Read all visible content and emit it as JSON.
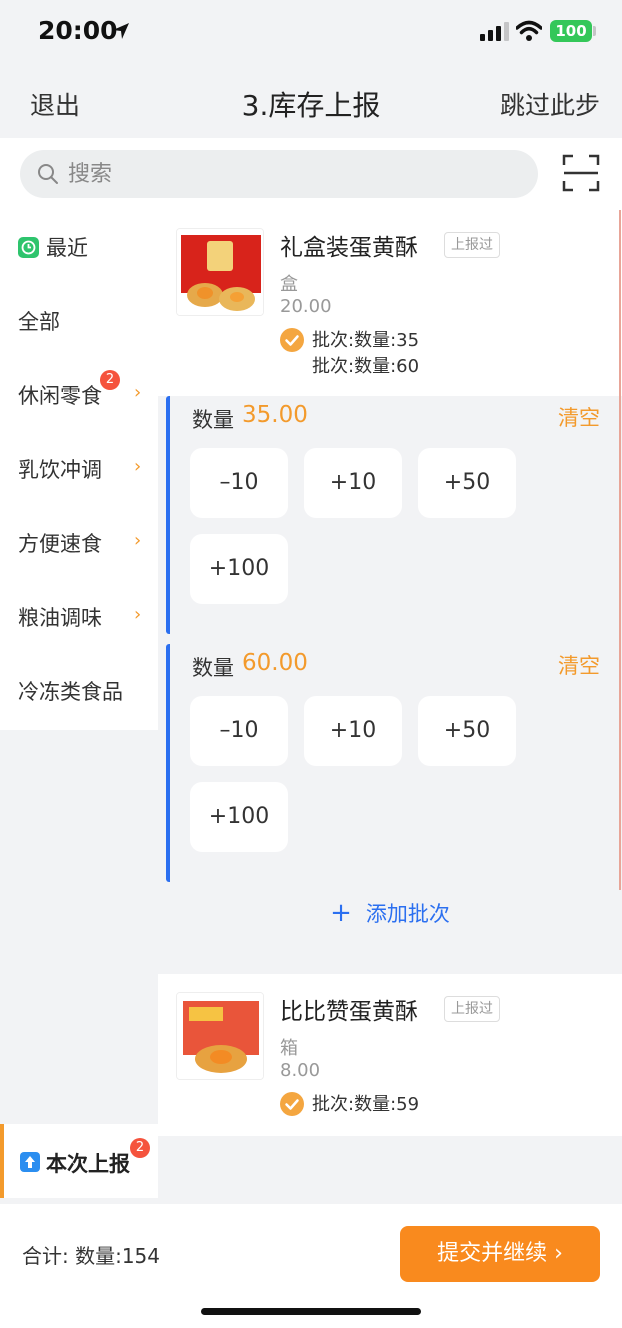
{
  "status": {
    "time": "20:00",
    "battery": "100"
  },
  "nav": {
    "left": "退出",
    "title": "3.库存上报",
    "right": "跳过此步"
  },
  "search": {
    "placeholder": "搜索"
  },
  "sidebar": {
    "items": [
      {
        "label": "最近",
        "icon": "clock-icon"
      },
      {
        "label": "全部"
      },
      {
        "label": "休闲零食",
        "badge": "2",
        "expandable": true
      },
      {
        "label": "乳饮冲调",
        "expandable": true
      },
      {
        "label": "方便速食",
        "expandable": true
      },
      {
        "label": "粮油调味",
        "expandable": true
      },
      {
        "label": "冷冻类食品"
      }
    ],
    "current_report": {
      "label": "本次上报",
      "badge": "2",
      "icon": "upload-icon"
    }
  },
  "products": [
    {
      "name": "礼盒装蛋黄酥",
      "tag": "上报过",
      "unit": "盒",
      "price": "20.00",
      "batches_summary": [
        "批次:数量:35",
        "批次:数量:60"
      ],
      "batches": [
        {
          "qty_label": "数量",
          "qty_value": "35.00",
          "clear_label": "清空",
          "buttons": [
            "–10",
            "+10",
            "+50",
            "+100"
          ]
        },
        {
          "qty_label": "数量",
          "qty_value": "60.00",
          "clear_label": "清空",
          "buttons": [
            "–10",
            "+10",
            "+50",
            "+100"
          ]
        }
      ],
      "add_batch_label": "添加批次"
    },
    {
      "name": "比比赞蛋黄酥",
      "tag": "上报过",
      "unit": "箱",
      "price": "8.00",
      "batches_summary": [
        "批次:数量:59"
      ]
    }
  ],
  "footer": {
    "total": "合计:  数量:154",
    "submit": "提交并继续 ›"
  },
  "colors": {
    "accent": "#f39a2c",
    "submit": "#f98a1e",
    "blue": "#2b6ff0",
    "badge": "#f5533d"
  }
}
